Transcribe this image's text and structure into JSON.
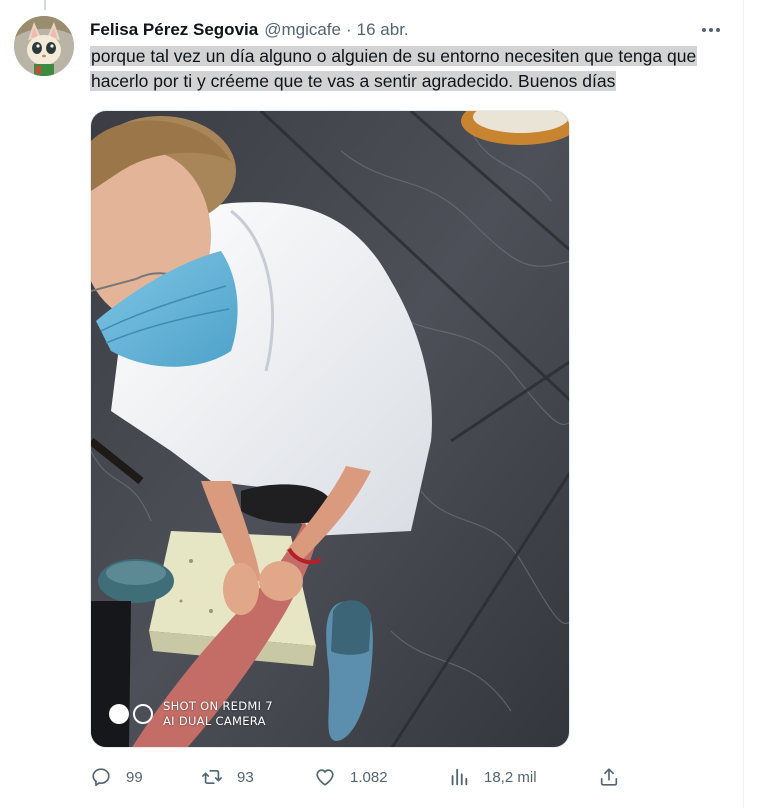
{
  "tweet": {
    "display_name": "Felisa Pérez Segovia",
    "handle": "@mgicafe",
    "separator": "·",
    "time": "16 abr.",
    "text": "porque tal vez un día alguno o alguien de su entorno necesiten que tenga que hacerlo por ti y créeme que te vas a sentir agradecido. Buenos días",
    "media": {
      "watermark_line1": "SHOT ON REDMI 7",
      "watermark_line2": "AI DUAL CAMERA"
    },
    "actions": {
      "replies": "99",
      "retweets": "93",
      "likes": "1.082",
      "views": "18,2 mil"
    }
  },
  "icons": {
    "more": "more-dots-icon",
    "reply": "reply-icon",
    "retweet": "retweet-icon",
    "like": "heart-icon",
    "views": "views-chart-icon",
    "share": "share-icon"
  },
  "colors": {
    "text": "#0f1419",
    "secondary": "#536471",
    "highlight": "#d3d3d3",
    "divider": "#eff3f4"
  }
}
